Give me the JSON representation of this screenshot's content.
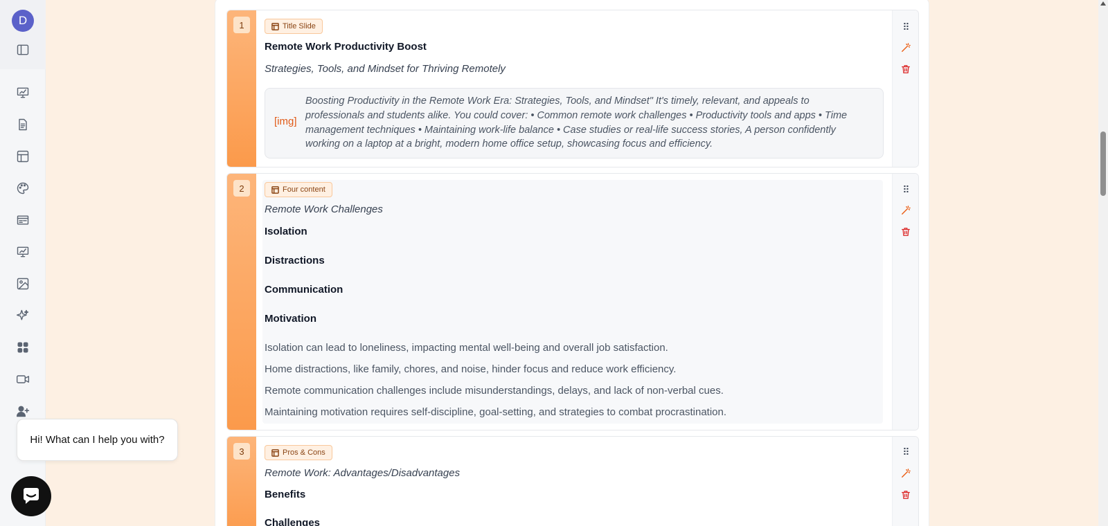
{
  "sidebar": {
    "avatar_initial": "D",
    "items": [
      {
        "icon": "sidebar-toggle-icon"
      },
      {
        "icon": "presentation-chart-icon"
      },
      {
        "icon": "document-icon"
      },
      {
        "icon": "layout-icon"
      },
      {
        "icon": "palette-icon"
      },
      {
        "icon": "slides-card-icon"
      },
      {
        "icon": "presentation-chart-icon"
      },
      {
        "icon": "image-icon"
      },
      {
        "icon": "sparkles-icon"
      },
      {
        "icon": "apps-grid-icon"
      },
      {
        "icon": "video-icon"
      },
      {
        "icon": "add-user-icon"
      }
    ]
  },
  "slides": [
    {
      "number": "1",
      "layout_badge": "Title Slide",
      "title": "Remote Work Productivity Boost",
      "subtitle": "Strategies, Tools, and Mindset for Thriving Remotely",
      "image_tag": "[img]",
      "image_prompt": "Boosting Productivity in the Remote Work Era: Strategies, Tools, and Mindset\" It's timely, relevant, and appeals to professionals and students alike. You could cover: • Common remote work challenges • Productivity tools and apps • Time management techniques • Maintaining work-life balance • Case studies or real-life success stories, A person confidently working on a laptop at a bright, modern home office setup, showcasing focus and efficiency."
    },
    {
      "number": "2",
      "layout_badge": "Four content",
      "subtitle": "Remote Work Challenges",
      "headings": [
        "Isolation",
        "Distractions",
        "Communication",
        "Motivation"
      ],
      "paragraphs": [
        "Isolation can lead to loneliness, impacting mental well-being and overall job satisfaction.",
        "Home distractions, like family, chores, and noise, hinder focus and reduce work efficiency.",
        "Remote communication challenges include misunderstandings, delays, and lack of non-verbal cues.",
        "Maintaining motivation requires self-discipline, goal-setting, and strategies to combat procrastination."
      ]
    },
    {
      "number": "3",
      "layout_badge": "Pros & Cons",
      "subtitle": "Remote Work: Advantages/Disadvantages",
      "headings": [
        "Benefits",
        "Challenges"
      ]
    }
  ],
  "slide_actions": {
    "drag": "⠿",
    "icons": [
      "drag-handle-icon",
      "magic-wand-icon",
      "trash-icon"
    ]
  },
  "chat": {
    "greeting": "Hi! What can I help you with?"
  },
  "colors": {
    "accent_orange": "#fb9a4b",
    "avatar": "#5b61c9",
    "delete_red": "#dc2626",
    "page_bg": "#fdf0e3"
  }
}
